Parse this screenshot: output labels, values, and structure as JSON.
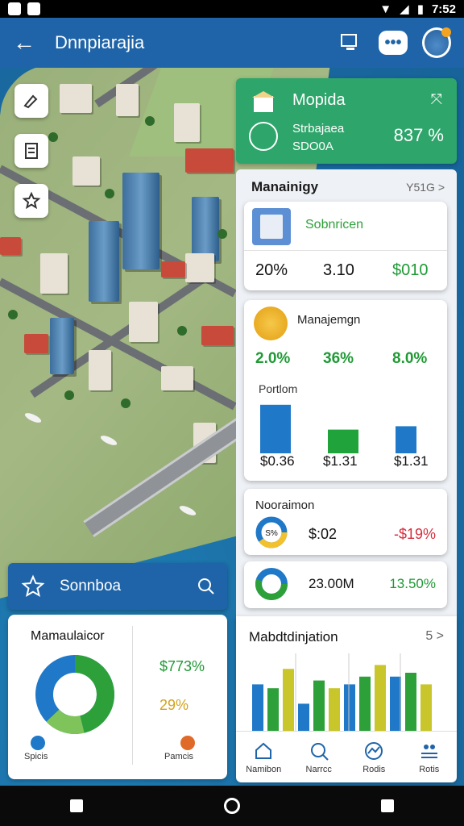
{
  "status": {
    "time": "7:52"
  },
  "appbar": {
    "title": "Dnnpiarajia"
  },
  "kpi_card": {
    "title": "Mopida",
    "sub1": "Strbajaea",
    "sub2": "SDO0A",
    "value": "837 %"
  },
  "section": {
    "title": "Manainigy",
    "meta": "Y51G >"
  },
  "card1": {
    "label": "Sobnricen",
    "values": [
      "20%",
      "3.10",
      "$010"
    ]
  },
  "card2": {
    "label": "Manajemgn",
    "percents": [
      "2.0%",
      "36%",
      "8.0%"
    ],
    "chart_label": "Portlom",
    "money": [
      "$0.36",
      "$1.31",
      "$1.31"
    ]
  },
  "card3": {
    "label": "Nooraimon",
    "donut_text": "S%",
    "mid": "$:02",
    "change": "-$19%"
  },
  "card4": {
    "mid": "23.00M",
    "change": "13.50%"
  },
  "card5": {
    "title": "Mabdtdinjation",
    "meta": "5 >"
  },
  "search": {
    "text": "Sonnboa"
  },
  "left_card": {
    "title": "Mamaulaicor",
    "v1": "$773%",
    "v2": "29%",
    "label1": "Spicis",
    "label2": "Pamcis"
  },
  "nav": {
    "items": [
      "Namibon",
      "Narrcc",
      "Rodis",
      "Rotis"
    ]
  },
  "colors": {
    "primary": "#1f64a8",
    "green": "#2ea56a",
    "negative": "#d62c3c",
    "positive": "#1f9a35",
    "yellow": "#c8c62a"
  },
  "chart_data": [
    {
      "type": "bar",
      "categories": [
        "1",
        "2",
        "3"
      ],
      "values": [
        86,
        42,
        48
      ]
    },
    {
      "type": "bar",
      "categories": [
        "1",
        "2",
        "3",
        "4",
        "5",
        "6",
        "7",
        "8",
        "9",
        "10",
        "11",
        "12"
      ],
      "series": [
        {
          "values": [
            60,
            55,
            80,
            35,
            65,
            55,
            60,
            70,
            85,
            70,
            75,
            60
          ]
        }
      ]
    }
  ]
}
